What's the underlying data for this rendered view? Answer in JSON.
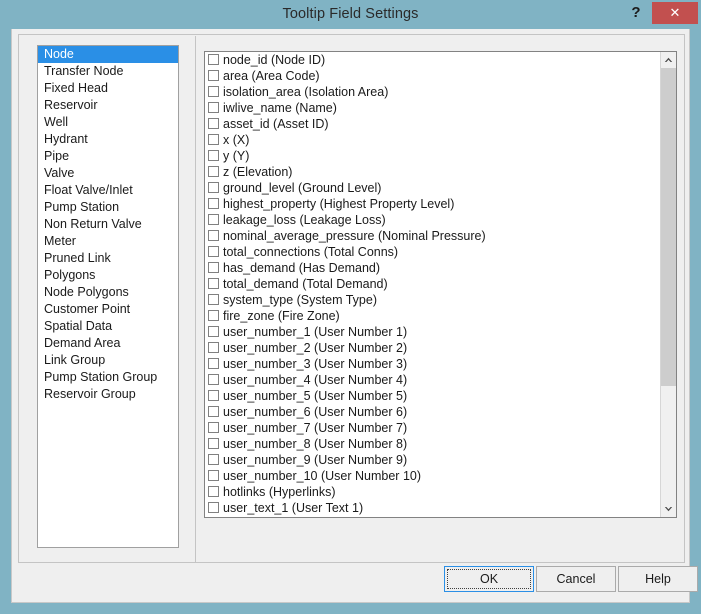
{
  "window": {
    "title": "Tooltip Field Settings",
    "help_icon": "question-mark-icon",
    "help_label": "?",
    "close_icon": "close-icon",
    "close_label": "✕",
    "titlebar_color": "#80b3c4",
    "close_button_color": "#c2504f",
    "selection_color": "#2a8fe6"
  },
  "categories": {
    "selected": "Node",
    "items": [
      {
        "label": "Node",
        "selected": true
      },
      {
        "label": "Transfer Node",
        "selected": false
      },
      {
        "label": "Fixed Head",
        "selected": false
      },
      {
        "label": "Reservoir",
        "selected": false
      },
      {
        "label": "Well",
        "selected": false
      },
      {
        "label": "Hydrant",
        "selected": false
      },
      {
        "label": "Pipe",
        "selected": false
      },
      {
        "label": "Valve",
        "selected": false
      },
      {
        "label": "Float Valve/Inlet",
        "selected": false
      },
      {
        "label": "Pump Station",
        "selected": false
      },
      {
        "label": "Non Return Valve",
        "selected": false
      },
      {
        "label": "Meter",
        "selected": false
      },
      {
        "label": "Pruned Link",
        "selected": false
      },
      {
        "label": "Polygons",
        "selected": false
      },
      {
        "label": "Node Polygons",
        "selected": false
      },
      {
        "label": "Customer Point",
        "selected": false
      },
      {
        "label": "Spatial Data",
        "selected": false
      },
      {
        "label": "Demand Area",
        "selected": false
      },
      {
        "label": "Link Group",
        "selected": false
      },
      {
        "label": "Pump Station Group",
        "selected": false
      },
      {
        "label": "Reservoir Group",
        "selected": false
      }
    ]
  },
  "fields": {
    "items": [
      {
        "label": "node_id (Node ID)",
        "checked": false
      },
      {
        "label": "area (Area Code)",
        "checked": false
      },
      {
        "label": "isolation_area (Isolation Area)",
        "checked": false
      },
      {
        "label": "iwlive_name (Name)",
        "checked": false
      },
      {
        "label": "asset_id (Asset ID)",
        "checked": false
      },
      {
        "label": "x (X)",
        "checked": false
      },
      {
        "label": "y (Y)",
        "checked": false
      },
      {
        "label": "z (Elevation)",
        "checked": false
      },
      {
        "label": "ground_level (Ground Level)",
        "checked": false
      },
      {
        "label": "highest_property (Highest Property Level)",
        "checked": false
      },
      {
        "label": "leakage_loss (Leakage Loss)",
        "checked": false
      },
      {
        "label": "nominal_average_pressure (Nominal Pressure)",
        "checked": false
      },
      {
        "label": "total_connections (Total Conns)",
        "checked": false
      },
      {
        "label": "has_demand (Has Demand)",
        "checked": false
      },
      {
        "label": "total_demand (Total Demand)",
        "checked": false
      },
      {
        "label": "system_type (System Type)",
        "checked": false
      },
      {
        "label": "fire_zone (Fire Zone)",
        "checked": false
      },
      {
        "label": "user_number_1 (User Number 1)",
        "checked": false
      },
      {
        "label": "user_number_2 (User Number 2)",
        "checked": false
      },
      {
        "label": "user_number_3 (User Number 3)",
        "checked": false
      },
      {
        "label": "user_number_4 (User Number 4)",
        "checked": false
      },
      {
        "label": "user_number_5 (User Number 5)",
        "checked": false
      },
      {
        "label": "user_number_6 (User Number 6)",
        "checked": false
      },
      {
        "label": "user_number_7 (User Number 7)",
        "checked": false
      },
      {
        "label": "user_number_8 (User Number 8)",
        "checked": false
      },
      {
        "label": "user_number_9 (User Number 9)",
        "checked": false
      },
      {
        "label": "user_number_10 (User Number 10)",
        "checked": false
      },
      {
        "label": "hotlinks (Hyperlinks)",
        "checked": false
      },
      {
        "label": "user_text_1 (User Text 1)",
        "checked": false
      }
    ],
    "scrollbar": {
      "up_arrow_icon": "chevron-up-icon",
      "down_arrow_icon": "chevron-down-icon"
    }
  },
  "buttons": {
    "ok": "OK",
    "cancel": "Cancel",
    "help": "Help",
    "focused": "OK"
  }
}
